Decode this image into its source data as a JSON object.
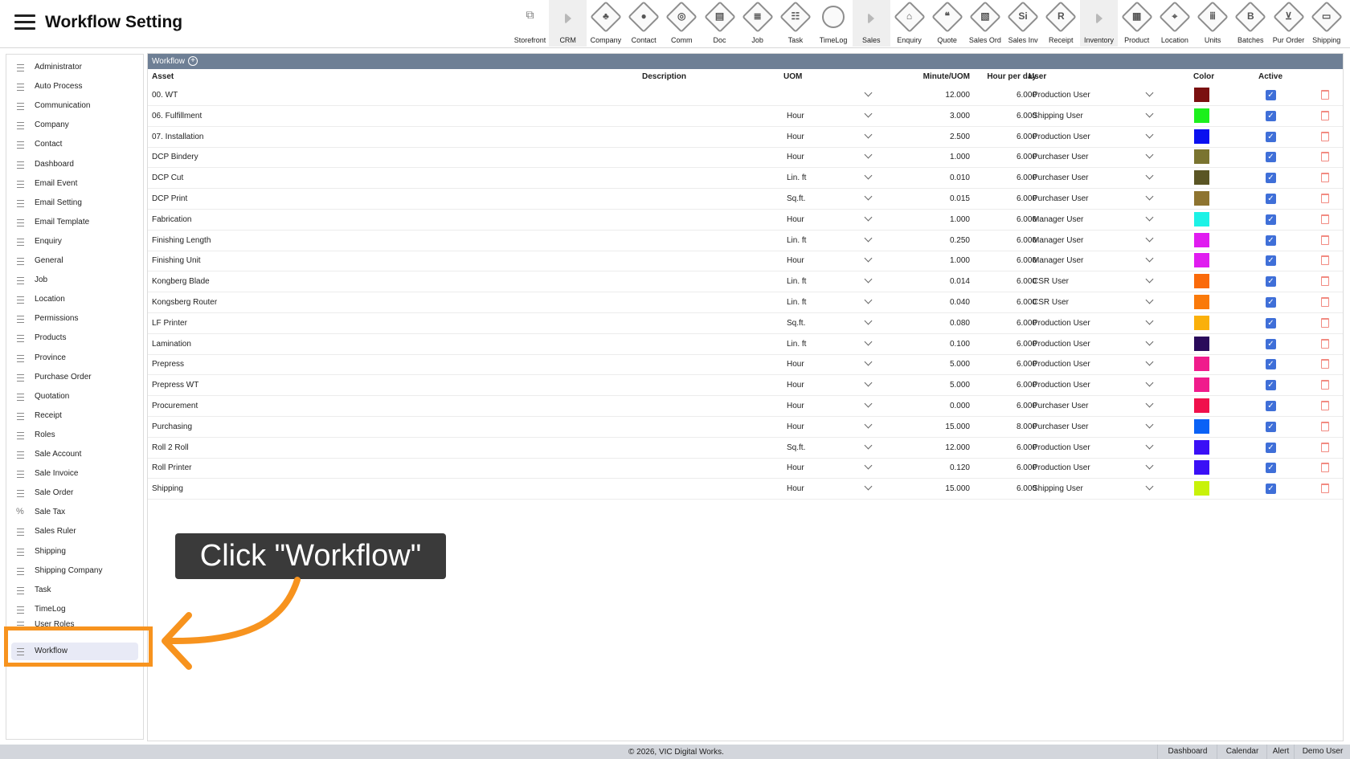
{
  "header": {
    "title": "Workflow Setting",
    "toolbar": [
      {
        "label": "Storefront",
        "icon": "external-link-icon",
        "glyph": "⧉"
      },
      {
        "label": "CRM",
        "icon": "expand-arrow-icon",
        "glyph": ""
      },
      {
        "label": "Company",
        "icon": "company-icon",
        "glyph": "♣"
      },
      {
        "label": "Contact",
        "icon": "contact-icon",
        "glyph": "●"
      },
      {
        "label": "Comm",
        "icon": "comm-icon",
        "glyph": "◎"
      },
      {
        "label": "Doc",
        "icon": "doc-icon",
        "glyph": "▤"
      },
      {
        "label": "Job",
        "icon": "job-icon",
        "glyph": "≣"
      },
      {
        "label": "Task",
        "icon": "task-icon",
        "glyph": "☷"
      },
      {
        "label": "TimeLog",
        "icon": "clock-icon",
        "glyph": ""
      },
      {
        "label": "Sales",
        "icon": "expand-arrow-icon",
        "glyph": ""
      },
      {
        "label": "Enquiry",
        "icon": "enquiry-icon",
        "glyph": "⌂"
      },
      {
        "label": "Quote",
        "icon": "quote-icon",
        "glyph": "❝"
      },
      {
        "label": "Sales Ord",
        "icon": "sales-order-icon",
        "glyph": "▧"
      },
      {
        "label": "Sales Inv",
        "icon": "sales-invoice-icon",
        "glyph": "Si"
      },
      {
        "label": "Receipt",
        "icon": "receipt-icon",
        "glyph": "R"
      },
      {
        "label": "Inventory",
        "icon": "expand-arrow-icon",
        "glyph": ""
      },
      {
        "label": "Product",
        "icon": "product-icon",
        "glyph": "▦"
      },
      {
        "label": "Location",
        "icon": "location-icon",
        "glyph": "⌖"
      },
      {
        "label": "Units",
        "icon": "units-icon",
        "glyph": "ⅲ"
      },
      {
        "label": "Batches",
        "icon": "batches-icon",
        "glyph": "B"
      },
      {
        "label": "Pur Order",
        "icon": "cart-icon",
        "glyph": "⊻"
      },
      {
        "label": "Shipping",
        "icon": "truck-icon",
        "glyph": "▭"
      }
    ]
  },
  "sidebar": {
    "items": [
      {
        "label": "Administrator"
      },
      {
        "label": "Auto Process"
      },
      {
        "label": "Communication"
      },
      {
        "label": "Company"
      },
      {
        "label": "Contact"
      },
      {
        "label": "Dashboard"
      },
      {
        "label": "Email Event"
      },
      {
        "label": "Email Setting"
      },
      {
        "label": "Email Template"
      },
      {
        "label": "Enquiry"
      },
      {
        "label": "General"
      },
      {
        "label": "Job"
      },
      {
        "label": "Location"
      },
      {
        "label": "Permissions"
      },
      {
        "label": "Products"
      },
      {
        "label": "Province"
      },
      {
        "label": "Purchase Order"
      },
      {
        "label": "Quotation"
      },
      {
        "label": "Receipt"
      },
      {
        "label": "Roles"
      },
      {
        "label": "Sale Account"
      },
      {
        "label": "Sale Invoice"
      },
      {
        "label": "Sale Order"
      },
      {
        "label": "Sale Tax",
        "icon": "percent-icon"
      },
      {
        "label": "Sales Ruler"
      },
      {
        "label": "Shipping"
      },
      {
        "label": "Shipping Company"
      },
      {
        "label": "Task"
      },
      {
        "label": "TimeLog"
      },
      {
        "label": "User Roles"
      },
      {
        "label": "Workflow",
        "active": true
      }
    ]
  },
  "panel": {
    "title": "Workflow",
    "columns": {
      "asset": "Asset",
      "description": "Description",
      "uom": "UOM",
      "minute_uom": "Minute/UOM",
      "hour_per_day": "Hour per day",
      "user": "User",
      "color": "Color",
      "active": "Active"
    },
    "rows": [
      {
        "asset": "00. WT",
        "uom": "",
        "minute": "12.000",
        "hours": "6.000",
        "user": "Production User",
        "color": "#7a1010"
      },
      {
        "asset": "06. Fulfillment",
        "uom": "Hour",
        "minute": "3.000",
        "hours": "6.000",
        "user": "Shipping User",
        "color": "#1cf01c"
      },
      {
        "asset": "07. Installation",
        "uom": "Hour",
        "minute": "2.500",
        "hours": "6.000",
        "user": "Production User",
        "color": "#0a10f0"
      },
      {
        "asset": "DCP Bindery",
        "uom": "Hour",
        "minute": "1.000",
        "hours": "6.000",
        "user": "Purchaser User",
        "color": "#7a7430"
      },
      {
        "asset": "DCP Cut",
        "uom": "Lin. ft",
        "minute": "0.010",
        "hours": "6.000",
        "user": "Purchaser User",
        "color": "#5a5524"
      },
      {
        "asset": "DCP Print",
        "uom": "Sq.ft.",
        "minute": "0.015",
        "hours": "6.000",
        "user": "Purchaser User",
        "color": "#8e7430"
      },
      {
        "asset": "Fabrication",
        "uom": "Hour",
        "minute": "1.000",
        "hours": "6.000",
        "user": "Manager User",
        "color": "#1cf2e6"
      },
      {
        "asset": "Finishing Length",
        "uom": "Lin. ft",
        "minute": "0.250",
        "hours": "6.000",
        "user": "Manager User",
        "color": "#e01cf0"
      },
      {
        "asset": "Finishing Unit",
        "uom": "Hour",
        "minute": "1.000",
        "hours": "6.000",
        "user": "Manager User",
        "color": "#e01cf0"
      },
      {
        "asset": "Kongberg Blade",
        "uom": "Lin. ft",
        "minute": "0.014",
        "hours": "6.000",
        "user": "CSR User",
        "color": "#fa6a0a"
      },
      {
        "asset": "Kongsberg Router",
        "uom": "Lin. ft",
        "minute": "0.040",
        "hours": "6.000",
        "user": "CSR User",
        "color": "#fa7a0a"
      },
      {
        "asset": "LF Printer",
        "uom": "Sq.ft.",
        "minute": "0.080",
        "hours": "6.000",
        "user": "Production User",
        "color": "#fab00a"
      },
      {
        "asset": "Lamination",
        "uom": "Lin. ft",
        "minute": "0.100",
        "hours": "6.000",
        "user": "Production User",
        "color": "#2a0a5a"
      },
      {
        "asset": "Prepress",
        "uom": "Hour",
        "minute": "5.000",
        "hours": "6.000",
        "user": "Production User",
        "color": "#f01c8c"
      },
      {
        "asset": "Prepress WT",
        "uom": "Hour",
        "minute": "5.000",
        "hours": "6.000",
        "user": "Production User",
        "color": "#f01c8c"
      },
      {
        "asset": "Procurement",
        "uom": "Hour",
        "minute": "0.000",
        "hours": "6.000",
        "user": "Purchaser User",
        "color": "#f0104c"
      },
      {
        "asset": "Purchasing",
        "uom": "Hour",
        "minute": "15.000",
        "hours": "8.000",
        "user": "Purchaser User",
        "color": "#0a62f6"
      },
      {
        "asset": "Roll 2 Roll",
        "uom": "Sq.ft.",
        "minute": "12.000",
        "hours": "6.000",
        "user": "Production User",
        "color": "#3a10f6"
      },
      {
        "asset": "Roll Printer",
        "uom": "Hour",
        "minute": "0.120",
        "hours": "6.000",
        "user": "Production User",
        "color": "#3a10f6"
      },
      {
        "asset": "Shipping",
        "uom": "Hour",
        "minute": "15.000",
        "hours": "6.000",
        "user": "Shipping User",
        "color": "#c8f20a"
      }
    ]
  },
  "callout": {
    "text": "Click \"Workflow\"",
    "accent": "#f7931e"
  },
  "footer": {
    "copyright": "© 2026, VIC Digital Works.",
    "links": [
      "Dashboard",
      "Calendar",
      "Alert",
      "Demo User"
    ]
  },
  "colors": {
    "panel_header": "#6e7f95",
    "checkbox": "#3f6fd8",
    "footer": "#d3d6dc"
  }
}
